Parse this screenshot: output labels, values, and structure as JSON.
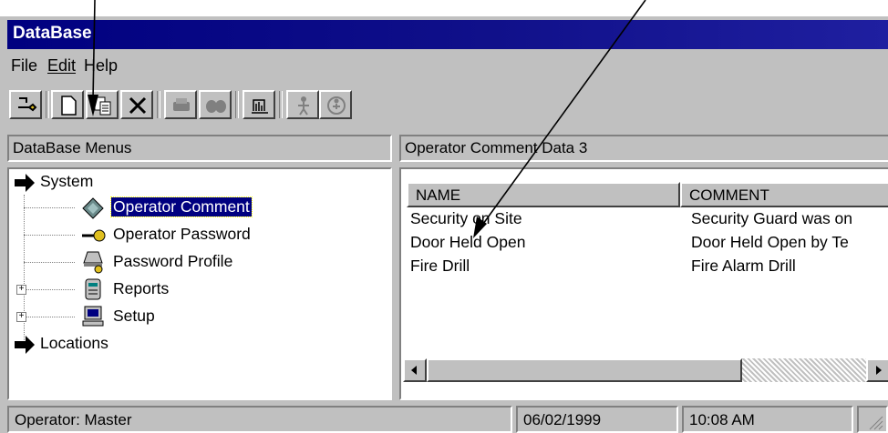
{
  "window": {
    "title": "DataBase"
  },
  "menu": [
    "File",
    "Edit",
    "Help"
  ],
  "toolbar": {
    "buttons": [
      "keys-icon",
      "new-document-icon",
      "copy-icon",
      "delete-icon",
      "printer-icon",
      "binoculars-icon",
      "chart-icon",
      "person-icon",
      "person-globe-icon"
    ]
  },
  "left_panel": {
    "header": "DataBase Menus",
    "tree": [
      {
        "label": "System",
        "icon": "arrow-right-icon",
        "level": 0
      },
      {
        "label": "Operator Comment",
        "icon": "pencil-icon",
        "level": 1,
        "selected": true
      },
      {
        "label": "Operator Password",
        "icon": "key-icon",
        "level": 1
      },
      {
        "label": "Password Profile",
        "icon": "profile-key-icon",
        "level": 1
      },
      {
        "label": "Reports",
        "icon": "report-icon",
        "level": 1,
        "expandable": true
      },
      {
        "label": "Setup",
        "icon": "computer-icon",
        "level": 1,
        "expandable": true
      },
      {
        "label": "Locations",
        "icon": "arrow-right-icon",
        "level": 0
      }
    ]
  },
  "right_panel": {
    "header": "Operator Comment Data   3",
    "columns": [
      "NAME",
      "COMMENT"
    ],
    "rows": [
      [
        "Security on Site",
        "Security Guard was on"
      ],
      [
        "Door Held Open",
        "Door Held Open by Te"
      ],
      [
        "Fire Drill",
        "Fire Alarm Drill"
      ]
    ]
  },
  "status": {
    "operator": "Operator:  Master",
    "date": "06/02/1999",
    "time": "10:08 AM"
  },
  "colors": {
    "title_bar": "#000080",
    "face": "#c0c0c0",
    "selection": "#000080"
  }
}
